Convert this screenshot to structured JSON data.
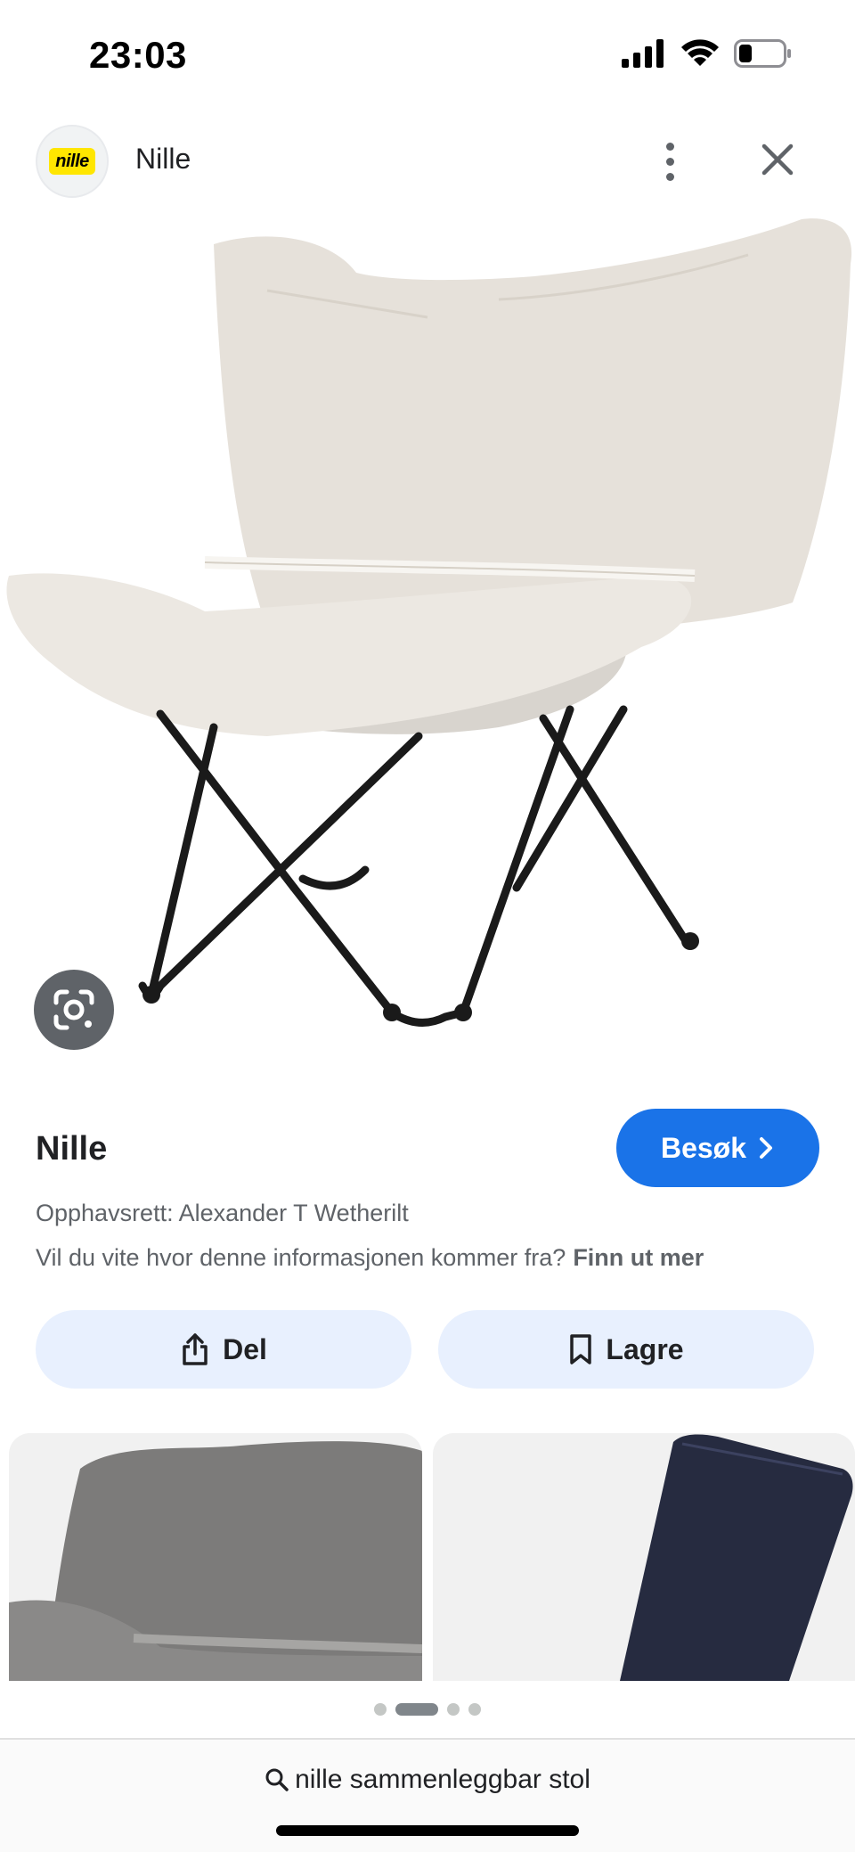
{
  "status": {
    "time": "23:03",
    "icons": [
      "cellular-signal-icon",
      "wifi-icon",
      "battery-icon"
    ],
    "battery_level": 0.3
  },
  "header": {
    "logo_text": "nille",
    "title": "Nille",
    "more_icon": "more-vert-icon",
    "close_icon": "close-icon"
  },
  "image": {
    "subject": "chair-photo",
    "lens_icon": "google-lens-icon"
  },
  "source": {
    "name": "Nille",
    "visit_label": "Besøk",
    "copyright": "Opphavsrett: Alexander T Wetherilt",
    "info_question": "Vil du vite hvor denne informasjonen kommer fra?",
    "info_link": "Finn ut mer"
  },
  "actions": {
    "share_label": "Del",
    "save_label": "Lagre"
  },
  "pager": {
    "count": 4,
    "active_index": 1
  },
  "search": {
    "query": "nille sammenleggbar stol",
    "icon": "search-icon"
  },
  "colors": {
    "accent": "#1a73e8",
    "action_bg": "#e8f0fe",
    "brand_yellow": "#ffe600"
  }
}
